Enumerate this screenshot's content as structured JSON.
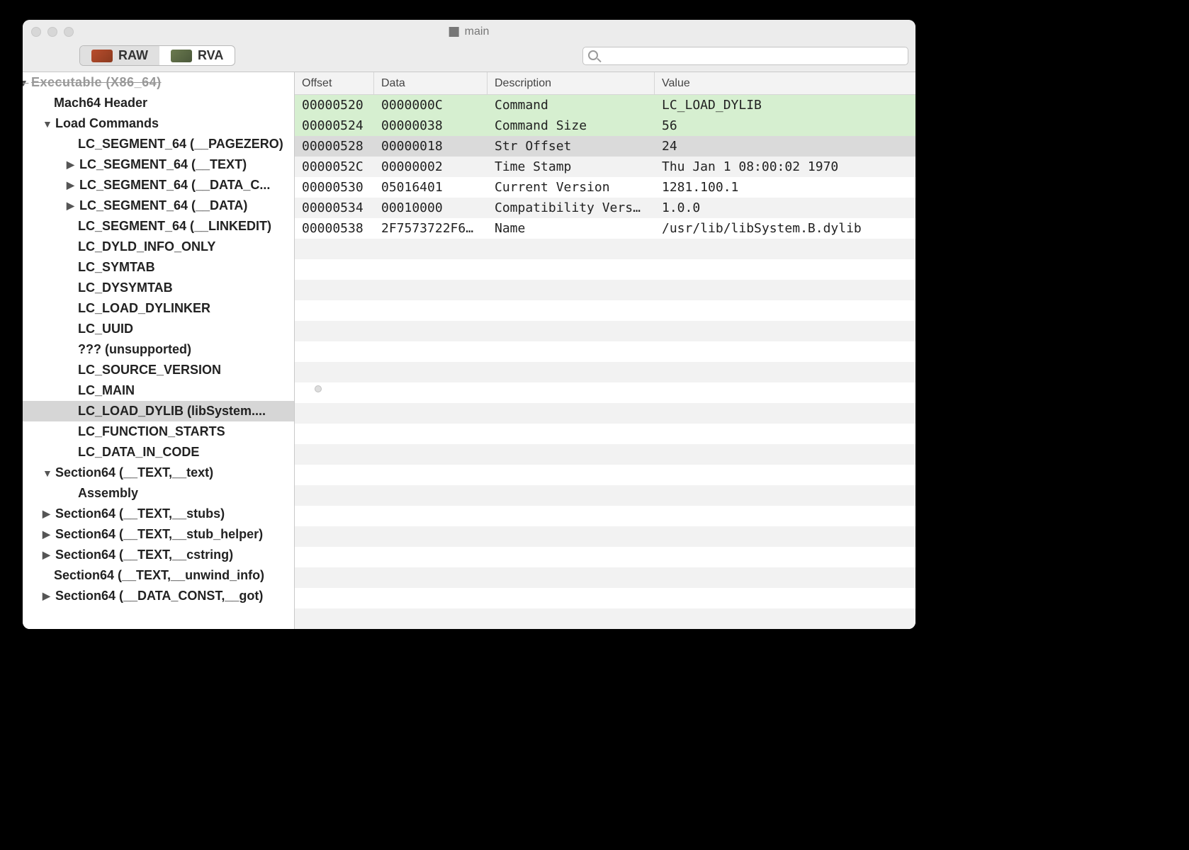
{
  "window": {
    "title": "main"
  },
  "toolbar": {
    "segments": {
      "raw": "RAW",
      "rva": "RVA"
    },
    "search_placeholder": ""
  },
  "sidebar": {
    "items": [
      {
        "label": "Executable  (X86_64)",
        "indent": 0,
        "disclosure": "down",
        "topcut": true
      },
      {
        "label": "Mach64 Header",
        "indent": 1,
        "disclosure": ""
      },
      {
        "label": "Load Commands",
        "indent": 1,
        "disclosure": "down"
      },
      {
        "label": "LC_SEGMENT_64 (__PAGEZERO)",
        "indent": 3,
        "disclosure": ""
      },
      {
        "label": "LC_SEGMENT_64 (__TEXT)",
        "indent": 3,
        "disclosure": "right"
      },
      {
        "label": "LC_SEGMENT_64 (__DATA_C...",
        "indent": 3,
        "disclosure": "right"
      },
      {
        "label": "LC_SEGMENT_64 (__DATA)",
        "indent": 3,
        "disclosure": "right"
      },
      {
        "label": "LC_SEGMENT_64 (__LINKEDIT)",
        "indent": 3,
        "disclosure": ""
      },
      {
        "label": "LC_DYLD_INFO_ONLY",
        "indent": 3,
        "disclosure": ""
      },
      {
        "label": "LC_SYMTAB",
        "indent": 3,
        "disclosure": ""
      },
      {
        "label": "LC_DYSYMTAB",
        "indent": 3,
        "disclosure": ""
      },
      {
        "label": "LC_LOAD_DYLINKER",
        "indent": 3,
        "disclosure": ""
      },
      {
        "label": "LC_UUID",
        "indent": 3,
        "disclosure": ""
      },
      {
        "label": "??? (unsupported)",
        "indent": 3,
        "disclosure": ""
      },
      {
        "label": "LC_SOURCE_VERSION",
        "indent": 3,
        "disclosure": ""
      },
      {
        "label": "LC_MAIN",
        "indent": 3,
        "disclosure": ""
      },
      {
        "label": "LC_LOAD_DYLIB (libSystem....",
        "indent": 3,
        "disclosure": "",
        "selected": true
      },
      {
        "label": "LC_FUNCTION_STARTS",
        "indent": 3,
        "disclosure": ""
      },
      {
        "label": "LC_DATA_IN_CODE",
        "indent": 3,
        "disclosure": ""
      },
      {
        "label": "Section64 (__TEXT,__text)",
        "indent": 1,
        "disclosure": "down"
      },
      {
        "label": "Assembly",
        "indent": 3,
        "disclosure": ""
      },
      {
        "label": "Section64 (__TEXT,__stubs)",
        "indent": 1,
        "disclosure": "right"
      },
      {
        "label": "Section64 (__TEXT,__stub_helper)",
        "indent": 1,
        "disclosure": "right"
      },
      {
        "label": "Section64 (__TEXT,__cstring)",
        "indent": 1,
        "disclosure": "right"
      },
      {
        "label": "Section64 (__TEXT,__unwind_info)",
        "indent": 1,
        "disclosure": ""
      },
      {
        "label": "Section64 (__DATA_CONST,__got)",
        "indent": 1,
        "disclosure": "right"
      }
    ]
  },
  "table": {
    "columns": {
      "offset": "Offset",
      "data": "Data",
      "description": "Description",
      "value": "Value"
    },
    "rows": [
      {
        "offset": "00000520",
        "data": "0000000C",
        "description": "Command",
        "value": "LC_LOAD_DYLIB",
        "hl": "green"
      },
      {
        "offset": "00000524",
        "data": "00000038",
        "description": "Command Size",
        "value": "56",
        "hl": "green"
      },
      {
        "offset": "00000528",
        "data": "00000018",
        "description": "Str Offset",
        "value": "24",
        "hl": "sel"
      },
      {
        "offset": "0000052C",
        "data": "00000002",
        "description": "Time Stamp",
        "value": "Thu Jan  1 08:00:02 1970",
        "hl": ""
      },
      {
        "offset": "00000530",
        "data": "05016401",
        "description": "Current Version",
        "value": "1281.100.1",
        "hl": ""
      },
      {
        "offset": "00000534",
        "data": "00010000",
        "description": "Compatibility Version",
        "value": "1.0.0",
        "hl": ""
      },
      {
        "offset": "00000538",
        "data": "2F7573722F6C…",
        "description": "Name",
        "value": "/usr/lib/libSystem.B.dylib",
        "hl": ""
      }
    ]
  }
}
